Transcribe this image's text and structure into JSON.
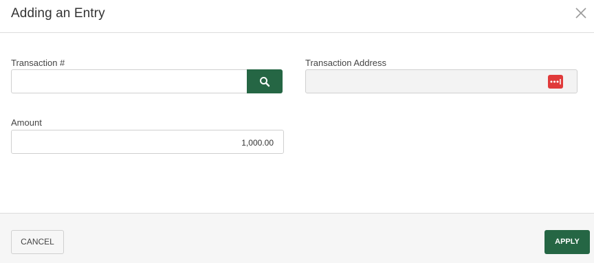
{
  "dialog": {
    "title": "Adding an Entry",
    "close_icon": "close-icon"
  },
  "form": {
    "transaction": {
      "label": "Transaction #",
      "value": "",
      "search_icon": "search-icon"
    },
    "address": {
      "label": "Transaction Address",
      "value": "",
      "more_icon": "more-options-icon"
    },
    "amount": {
      "label": "Amount",
      "value": "1,000.00"
    }
  },
  "footer": {
    "cancel_label": "CANCEL",
    "apply_label": "APPLY"
  },
  "colors": {
    "primary": "#256644",
    "more_button": "#e03a3a",
    "readonly_bg": "#f3f3f3"
  }
}
